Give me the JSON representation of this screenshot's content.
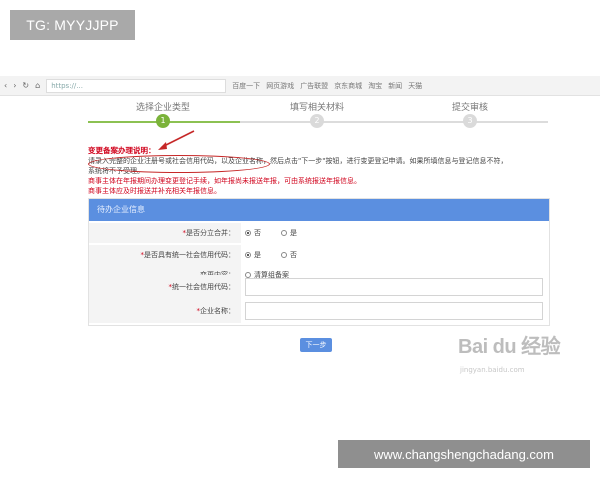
{
  "watermark_top": "TG: MYYJJPP",
  "watermark_bottom": "www.changshengchadang.com",
  "browser": {
    "url": "https://...",
    "bookmarks": [
      "百度一下",
      "网页游戏",
      "广告联盟",
      "京东商城",
      "淘宝",
      "新闻",
      "天猫"
    ]
  },
  "steps": [
    {
      "num": "1",
      "label": "选择企业类型",
      "active": true
    },
    {
      "num": "2",
      "label": "填写相关材料",
      "active": false
    },
    {
      "num": "3",
      "label": "提交审核",
      "active": false
    }
  ],
  "notes": {
    "title": "变更备案办理说明：",
    "line1": "请录入完整的企业注册号或社会信用代码，以及企业名称，然后点击\"下一步\"按钮，进行变更登记申请。如果所填信息与登记信息不符，",
    "line2": "系统将不予受理。",
    "warn1": "商事主体在年报期间办理变更登记手续，如年报尚未报送年报，可由系统报送年报信息。",
    "warn2": "商事主体应及时报送并补充相关年报信息。"
  },
  "panel": {
    "header": "待办企业信息",
    "rows": {
      "merge": {
        "label": "是否分立合并：",
        "options": [
          "否",
          "是"
        ],
        "selected": 0
      },
      "credit": {
        "label": "是否具有统一社会信用代码：",
        "options": [
          "是",
          "否"
        ],
        "selected": 0
      },
      "change": {
        "label": "变更内容：",
        "options": [
          "清算组备案"
        ],
        "selected": -1
      },
      "code": {
        "label": "统一社会信用代码：",
        "value": ""
      },
      "name": {
        "label": "企业名称：",
        "value": ""
      }
    }
  },
  "next_label": "下一步",
  "baidu": {
    "logo": "Bai du 经验",
    "sub": "jingyan.baidu.com"
  }
}
